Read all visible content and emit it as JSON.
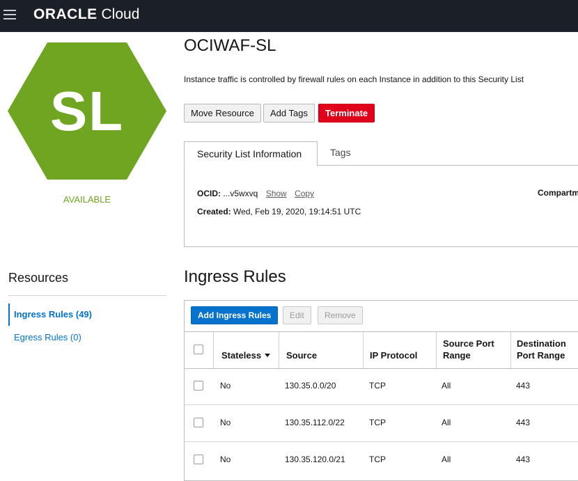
{
  "brand": {
    "oracle": "ORACLE",
    "cloud": "Cloud"
  },
  "resource": {
    "badge_text": "SL",
    "status": "AVAILABLE",
    "title": "OCIWAF-SL",
    "description": "Instance traffic is controlled by firewall rules on each Instance in addition to this Security List"
  },
  "actions": {
    "move": "Move Resource",
    "add_tags": "Add Tags",
    "terminate": "Terminate"
  },
  "tabs": {
    "info": "Security List Information",
    "tags": "Tags"
  },
  "info": {
    "ocid_label": "OCID:",
    "ocid_value": "...v5wxvq",
    "show": "Show",
    "copy": "Copy",
    "created_label": "Created:",
    "created_value": "Wed, Feb 19, 2020, 19:14:51 UTC",
    "compartment_label": "Compartm"
  },
  "resources": {
    "title": "Resources",
    "items": [
      {
        "label": "Ingress Rules (49)"
      },
      {
        "label": "Egress Rules (0)"
      }
    ]
  },
  "ingress": {
    "title": "Ingress Rules",
    "add_button": "Add Ingress Rules",
    "edit_button": "Edit",
    "remove_button": "Remove",
    "columns": {
      "stateless": "Stateless",
      "source": "Source",
      "ip_protocol": "IP Protocol",
      "source_port_1": "Source Port",
      "source_port_2": "Range",
      "dest_port_1": "Destination",
      "dest_port_2": "Port Range"
    },
    "rows": [
      {
        "stateless": "No",
        "source": "130.35.0.0/20",
        "protocol": "TCP",
        "src_port": "All",
        "dst_port": "443"
      },
      {
        "stateless": "No",
        "source": "130.35.112.0/22",
        "protocol": "TCP",
        "src_port": "All",
        "dst_port": "443"
      },
      {
        "stateless": "No",
        "source": "130.35.120.0/21",
        "protocol": "TCP",
        "src_port": "All",
        "dst_port": "443"
      }
    ]
  },
  "colors": {
    "badge": "#6fa521",
    "primary": "#0572ce",
    "danger": "#e0001b",
    "topbar": "#1b2028"
  }
}
